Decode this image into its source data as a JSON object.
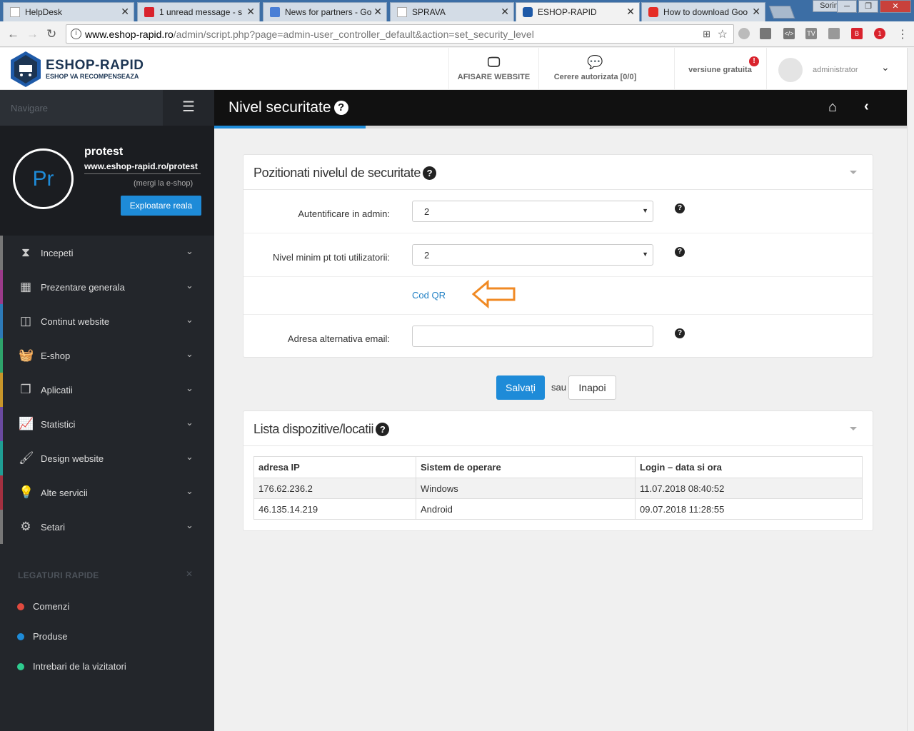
{
  "browser": {
    "tabs": [
      {
        "label": "HelpDesk",
        "icon_color": "#cfcfcf"
      },
      {
        "label": "1 unread message - s",
        "icon_color": "#d9232d"
      },
      {
        "label": "News for partners - Go",
        "icon_color": "#4a7fd6"
      },
      {
        "label": "SPRAVA",
        "icon_color": "#cfcfcf"
      },
      {
        "label": "ESHOP-RAPID",
        "icon_color": "#1e5aa8"
      },
      {
        "label": "How to download Goo",
        "icon_color": "#e52d27"
      }
    ],
    "profile_name": "Sorin",
    "url_host": "www.eshop-rapid.ro",
    "url_path": "/admin/script.php?page=admin-user_controller_default&action=set_security_level",
    "extension_badge": "1"
  },
  "header": {
    "logo_title": "ESHOP-RAPID",
    "logo_subtitle": "ESHOP VA RECOMPENSEAZA",
    "view_site_label": "AFISARE WEBSITE",
    "auth_request_label": "Cerere autorizata [0/0]",
    "version_label": "versiune gratuita",
    "version_badge": "!",
    "user_label": "administrator"
  },
  "sidebar": {
    "nav_label": "Navigare",
    "shop_name": "protest",
    "shop_url": "www.eshop-rapid.ro/protest",
    "goto_label": "(mergi la e-shop)",
    "avatar_initials": "Pr",
    "exploit_button": "Exploatare reala",
    "items": [
      {
        "label": "Incepeti",
        "icon": "hourglass-icon",
        "color": "#777777"
      },
      {
        "label": "Prezentare generala",
        "icon": "grid-icon",
        "color": "#9b3b8a"
      },
      {
        "label": "Continut website",
        "icon": "columns-icon",
        "color": "#2d7ab8"
      },
      {
        "label": "E-shop",
        "icon": "basket-icon",
        "color": "#2ea36b"
      },
      {
        "label": "Aplicatii",
        "icon": "cubes-icon",
        "color": "#c8962a"
      },
      {
        "label": "Statistici",
        "icon": "chart-icon",
        "color": "#6a4aa0"
      },
      {
        "label": "Design website",
        "icon": "brush-icon",
        "color": "#1f9e94"
      },
      {
        "label": "Alte servicii",
        "icon": "bulb-icon",
        "color": "#a33040"
      },
      {
        "label": "Setari",
        "icon": "gears-icon",
        "color": "#777777"
      }
    ],
    "quick_title": "LEGATURI RAPIDE",
    "quick_links": [
      {
        "label": "Comenzi",
        "color": "#e04a3f"
      },
      {
        "label": "Produse",
        "color": "#1e8bd8"
      },
      {
        "label": "Intrebari de la vizitatori",
        "color": "#2ecc8f"
      }
    ]
  },
  "page": {
    "title": "Nivel securitate",
    "security_panel": {
      "title": "Pozitionati nivelul de securitate",
      "admin_auth_label": "Autentificare in admin:",
      "admin_auth_value": "2",
      "min_level_label": "Nivel minim pt toti utilizatorii:",
      "min_level_value": "2",
      "qr_link": "Cod QR",
      "alt_email_label": "Adresa alternativa email:",
      "alt_email_value": ""
    },
    "save_label": "Salvați",
    "or_label": "sau",
    "back_label": "Inapoi",
    "devices_panel": {
      "title": "Lista dispozitive/locatii",
      "columns": [
        "adresa IP",
        "Sistem de operare",
        "Login – data si ora"
      ],
      "rows": [
        [
          "176.62.236.2",
          "Windows",
          "11.07.2018 08:40:52"
        ],
        [
          "46.135.14.219",
          "Android",
          "09.07.2018 11:28:55"
        ]
      ]
    }
  }
}
